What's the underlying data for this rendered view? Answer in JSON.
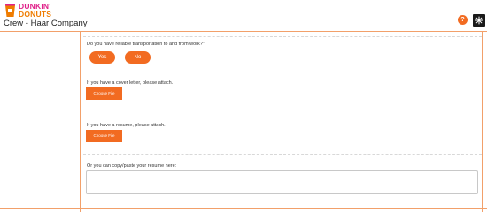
{
  "brand": {
    "line1": "DUNKIN'",
    "line2": "DONUTS"
  },
  "header": {
    "company": "Crew - Haar Company",
    "help_label": "?"
  },
  "form": {
    "transport": {
      "question": "Do you have reliable transportation to and from work?",
      "required_mark": "*",
      "yes_label": "Yes",
      "no_label": "No"
    },
    "cover_letter": {
      "label": "If you have a cover letter, please attach.",
      "button_label": "Choose File"
    },
    "resume": {
      "label": "If you have a resume, please attach.",
      "button_label": "Choose File"
    },
    "paste": {
      "label": "Or you can copy/paste your resume here:",
      "value": ""
    }
  },
  "colors": {
    "accent": "#f26b21",
    "pink": "#e0218a",
    "border": "#f2a06a"
  },
  "icons": {
    "help": "question-icon",
    "cup": "coffee-cup-icon",
    "corner": "sparkle-icon"
  }
}
